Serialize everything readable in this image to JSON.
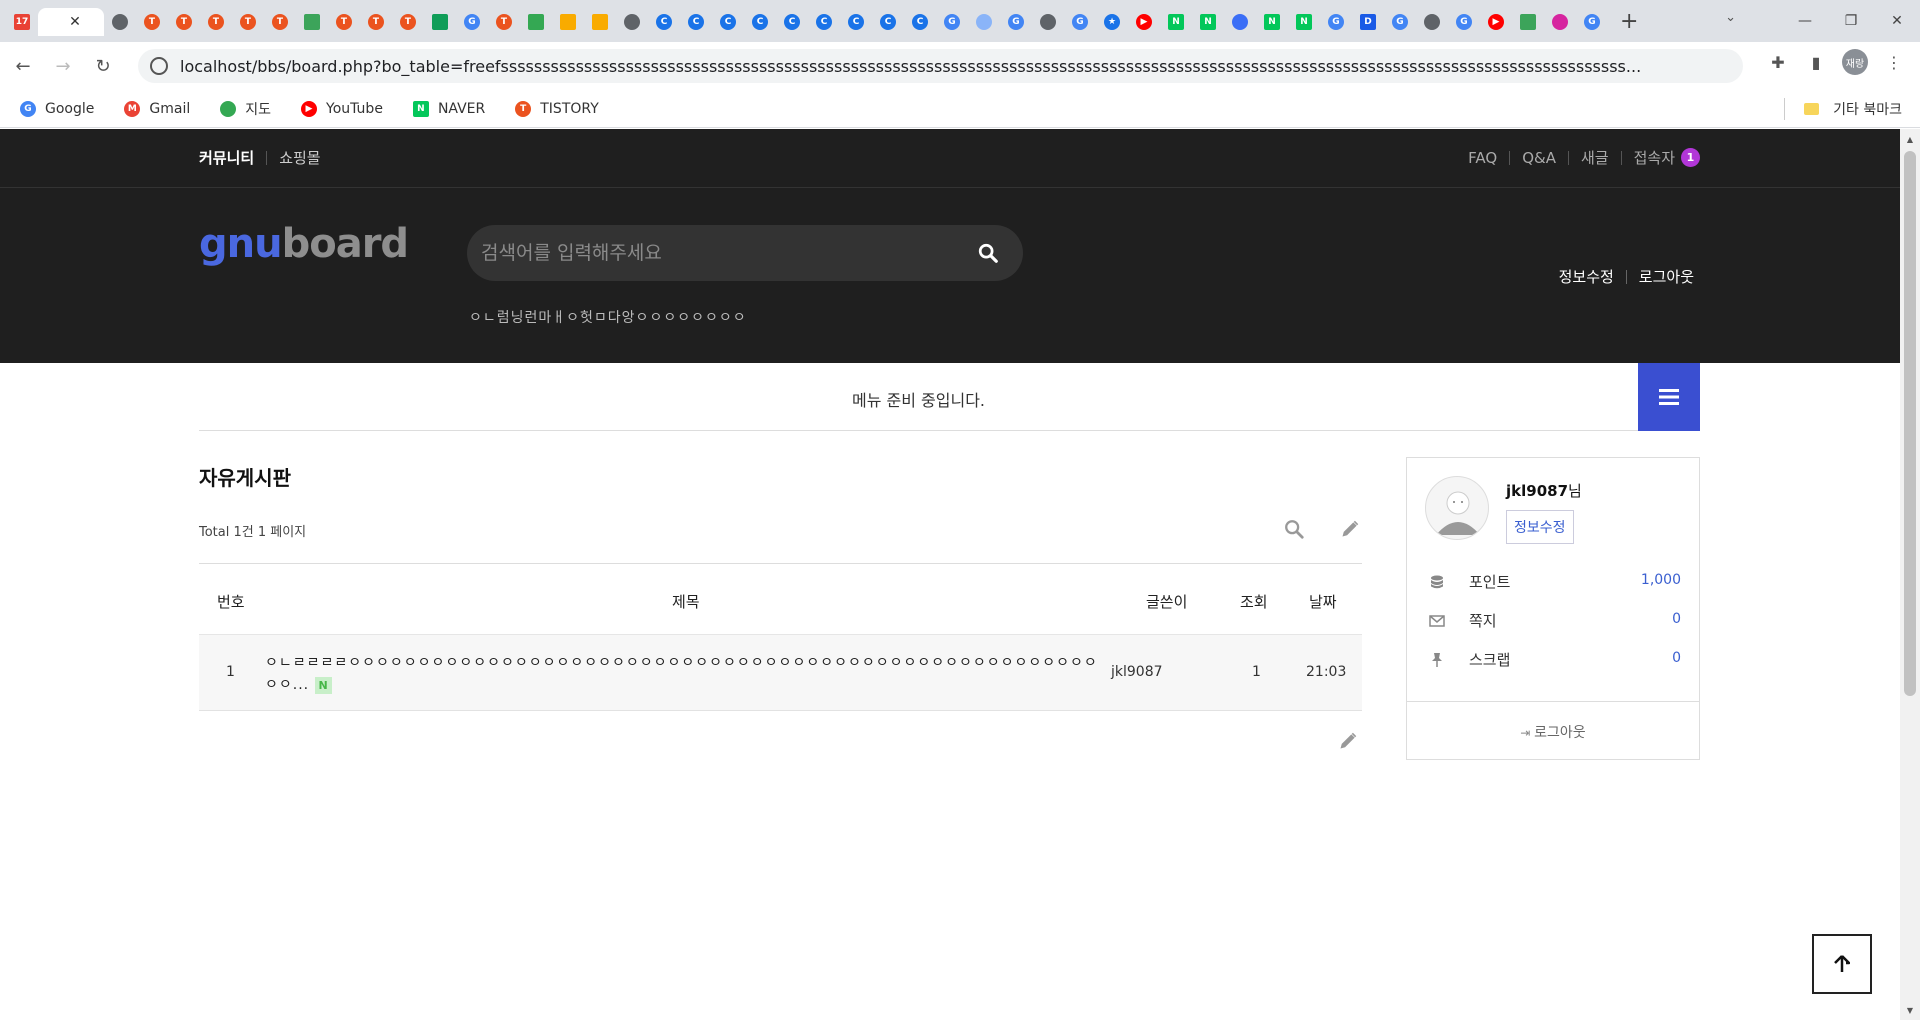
{
  "browser": {
    "tabs": [
      {
        "icon": "calendar-icon",
        "color": "#e94235",
        "glyph": "17"
      },
      {
        "icon": "globe-icon",
        "color": "#5f6368",
        "glyph": ""
      },
      {
        "icon": "tistory-icon",
        "color": "#eb531f",
        "glyph": "T"
      },
      {
        "icon": "tistory-icon",
        "color": "#eb531f",
        "glyph": "T"
      },
      {
        "icon": "tistory-icon",
        "color": "#eb531f",
        "glyph": "T"
      },
      {
        "icon": "tistory-icon",
        "color": "#eb531f",
        "glyph": "T"
      },
      {
        "icon": "tistory-icon",
        "color": "#eb531f",
        "glyph": "T"
      },
      {
        "icon": "bookmark-green-icon",
        "color": "#3ca45a",
        "glyph": ""
      },
      {
        "icon": "tistory-icon",
        "color": "#eb531f",
        "glyph": "T"
      },
      {
        "icon": "tistory-icon",
        "color": "#eb531f",
        "glyph": "T"
      },
      {
        "icon": "tistory-icon",
        "color": "#eb531f",
        "glyph": "T"
      },
      {
        "icon": "sheets-icon",
        "color": "#0f9d58",
        "glyph": ""
      },
      {
        "icon": "google-icon",
        "color": "#4285f4",
        "glyph": "G"
      },
      {
        "icon": "tistory-icon",
        "color": "#eb531f",
        "glyph": "T"
      },
      {
        "icon": "monitor-icon",
        "color": "#34a853",
        "glyph": ""
      },
      {
        "icon": "analytics-icon",
        "color": "#f9ab00",
        "glyph": ""
      },
      {
        "icon": "analytics-icon",
        "color": "#f9ab00",
        "glyph": ""
      },
      {
        "icon": "bookmark-icon",
        "color": "#5f6368",
        "glyph": ""
      },
      {
        "icon": "c-icon",
        "color": "#1a73e8",
        "glyph": "C"
      },
      {
        "icon": "c-icon",
        "color": "#1a73e8",
        "glyph": "C"
      },
      {
        "icon": "c-icon",
        "color": "#1a73e8",
        "glyph": "C"
      },
      {
        "icon": "c-icon",
        "color": "#1a73e8",
        "glyph": "C"
      },
      {
        "icon": "c-icon",
        "color": "#1a73e8",
        "glyph": "C"
      },
      {
        "icon": "c-icon",
        "color": "#1a73e8",
        "glyph": "C"
      },
      {
        "icon": "c-icon",
        "color": "#1a73e8",
        "glyph": "C"
      },
      {
        "icon": "c-icon",
        "color": "#1a73e8",
        "glyph": "C"
      },
      {
        "icon": "c-icon",
        "color": "#1a73e8",
        "glyph": "C"
      },
      {
        "icon": "google-icon",
        "color": "#4285f4",
        "glyph": "G"
      },
      {
        "icon": "cloud-icon",
        "color": "#8ab4f8",
        "glyph": ""
      },
      {
        "icon": "google-icon",
        "color": "#4285f4",
        "glyph": "G"
      },
      {
        "icon": "globe-icon",
        "color": "#5f6368",
        "glyph": ""
      },
      {
        "icon": "google-icon",
        "color": "#4285f4",
        "glyph": "G"
      },
      {
        "icon": "star-icon",
        "color": "#1a73e8",
        "glyph": "★"
      },
      {
        "icon": "youtube-icon",
        "color": "#ff0000",
        "glyph": "▶"
      },
      {
        "icon": "naver-icon",
        "color": "#03c75a",
        "glyph": "N"
      },
      {
        "icon": "naver-icon",
        "color": "#03c75a",
        "glyph": "N"
      },
      {
        "icon": "cube-icon",
        "color": "#3b6ef6",
        "glyph": ""
      },
      {
        "icon": "naver-icon",
        "color": "#03c75a",
        "glyph": "N"
      },
      {
        "icon": "naver-icon",
        "color": "#03c75a",
        "glyph": "N"
      },
      {
        "icon": "google-icon",
        "color": "#4285f4",
        "glyph": "G"
      },
      {
        "icon": "daum-icon",
        "color": "#1a5ae6",
        "glyph": "D"
      },
      {
        "icon": "google-icon",
        "color": "#4285f4",
        "glyph": "G"
      },
      {
        "icon": "globe-icon",
        "color": "#5f6368",
        "glyph": ""
      },
      {
        "icon": "google-icon",
        "color": "#4285f4",
        "glyph": "G"
      },
      {
        "icon": "youtube-icon",
        "color": "#ff0000",
        "glyph": "▶"
      },
      {
        "icon": "bookmark-green-icon",
        "color": "#3ca45a",
        "glyph": ""
      },
      {
        "icon": "instagram-icon",
        "color": "#d6249f",
        "glyph": ""
      },
      {
        "icon": "google-icon",
        "color": "#4285f4",
        "glyph": "G"
      }
    ],
    "url": "localhost/bbs/board.php?bo_table=freefsssssssssssssssssssssssssssssssssssssssssssssssssssssssssssssssssssssssssssssssssssssssssssssssssssssssssssssssssssssssssssssssssssssss...",
    "profile_label": "재랑",
    "bookmarks": [
      {
        "label": "Google",
        "icon": "google-icon",
        "color": "#4285f4",
        "glyph": "G"
      },
      {
        "label": "Gmail",
        "icon": "gmail-icon",
        "color": "#ea4335",
        "glyph": "M"
      },
      {
        "label": "지도",
        "icon": "maps-icon",
        "color": "#34a853",
        "glyph": ""
      },
      {
        "label": "YouTube",
        "icon": "youtube-icon",
        "color": "#ff0000",
        "glyph": "▶"
      },
      {
        "label": "NAVER",
        "icon": "naver-icon",
        "color": "#03c75a",
        "glyph": "N"
      },
      {
        "label": "TISTORY",
        "icon": "tistory-icon",
        "color": "#eb531f",
        "glyph": "T"
      }
    ],
    "other_bookmarks": "기타 북마크"
  },
  "topbar": {
    "community": "커뮤니티",
    "shop": "쇼핑몰",
    "faq": "FAQ",
    "qa": "Q&A",
    "new": "새글",
    "visitors": "접속자",
    "visitor_count": "1"
  },
  "header": {
    "logo_part1": "gnu",
    "logo_part2": "board",
    "search_placeholder": "검색어를 입력해주세요",
    "popular": "ㅇㄴ럼닝런마ㅐㅇ헛ㅁ다앙ㅇㅇㅇㅇㅇㅇㅇㅇ",
    "edit_info": "정보수정",
    "logout": "로그아웃"
  },
  "menu": {
    "message": "메뉴 준비 중입니다."
  },
  "board": {
    "title": "자유게시판",
    "total": "Total 1건 1 페이지",
    "columns": {
      "num": "번호",
      "subject": "제목",
      "author": "글쓴이",
      "hits": "조회",
      "date": "날짜"
    },
    "rows": [
      {
        "num": "1",
        "subject": "ㅇㄴㄹㄹㄹㄹㅇㅇㅇㅇㅇㅇㅇㅇㅇㅇㅇㅇㅇㅇㅇㅇㅇㅇㅇㅇㅇㅇㅇㅇㅇㅇㅇㅇㅇㅇㅇㅇㅇㅇㅇㅇㅇㅇㅇㅇㅇㅇㅇㅇㅇㅇㅇㅇㅇㅇㅇㅇㅇㅇㅇㅇ...",
        "new_badge": "N",
        "author": "jkl9087",
        "hits": "1",
        "date": "21:03"
      }
    ]
  },
  "sidebox": {
    "username": "jkl9087",
    "suffix": "님",
    "edit_button": "정보수정",
    "points_label": "포인트",
    "points_value": "1,000",
    "memo_label": "쪽지",
    "memo_value": "0",
    "scrap_label": "스크랩",
    "scrap_value": "0",
    "logout": "로그아웃"
  },
  "colors": {
    "accent": "#3a4fd1",
    "dark_bg": "#1f1f1f",
    "badge_purple": "#b236d8",
    "link_blue": "#3a5fd0"
  }
}
